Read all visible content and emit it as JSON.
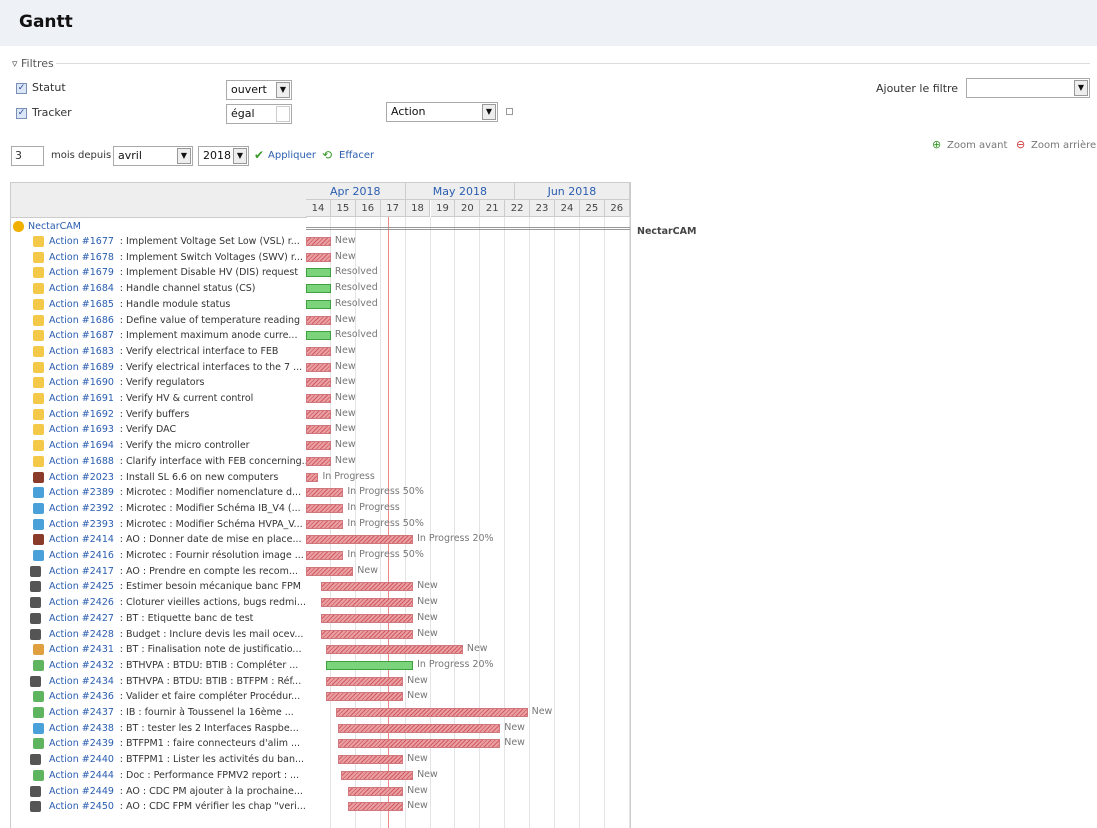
{
  "page": {
    "title": "Gantt"
  },
  "filters": {
    "legend": "▿ Filtres",
    "statut": {
      "label": "Statut",
      "operator": "ouvert"
    },
    "tracker": {
      "label": "Tracker",
      "operator": "égal",
      "value": "Action"
    },
    "add_filter_label": "Ajouter le filtre",
    "add_filter_value": ""
  },
  "controls": {
    "months": "3",
    "months_label": "mois depuis",
    "month_value": "avril",
    "year_value": "2018",
    "apply": "Appliquer",
    "clear": "Effacer",
    "zoom_in": "Zoom avant",
    "zoom_out": "Zoom arrière"
  },
  "timeline": {
    "months": [
      "Apr 2018",
      "May 2018",
      "Jun 2018"
    ],
    "weeks": [
      "14",
      "15",
      "16",
      "17",
      "18",
      "19",
      "20",
      "21",
      "22",
      "23",
      "24",
      "25",
      "26"
    ]
  },
  "project": {
    "name": "NectarCAM"
  },
  "colors": {
    "late": "#d45a61",
    "done": "#7bd37b",
    "todo": "#aaaaaa",
    "link": "#2a5db0"
  },
  "issues": [
    {
      "id": "Action #1677",
      "subject": "Implement Voltage Set Low (VSL) r...",
      "status": "New",
      "icon": "folder"
    },
    {
      "id": "Action #1678",
      "subject": "Implement Switch Voltages (SWV) r...",
      "status": "New",
      "icon": "folder"
    },
    {
      "id": "Action #1679",
      "subject": "Implement Disable HV (DIS) request",
      "status": "Resolved",
      "icon": "folder"
    },
    {
      "id": "Action #1684",
      "subject": "Handle channel status (CS)",
      "status": "Resolved",
      "icon": "folder"
    },
    {
      "id": "Action #1685",
      "subject": "Handle module status",
      "status": "Resolved",
      "icon": "folder"
    },
    {
      "id": "Action #1686",
      "subject": "Define value of temperature reading",
      "status": "New",
      "icon": "folder"
    },
    {
      "id": "Action #1687",
      "subject": "Implement maximum anode curre...",
      "status": "Resolved",
      "icon": "folder"
    },
    {
      "id": "Action #1683",
      "subject": "Verify electrical interface to FEB",
      "status": "New",
      "icon": "folder"
    },
    {
      "id": "Action #1689",
      "subject": "Verify electrical interfaces to the 7 ...",
      "status": "New",
      "icon": "folder"
    },
    {
      "id": "Action #1690",
      "subject": "Verify regulators",
      "status": "New",
      "icon": "folder"
    },
    {
      "id": "Action #1691",
      "subject": "Verify HV & current control",
      "status": "New",
      "icon": "folder"
    },
    {
      "id": "Action #1692",
      "subject": "Verify buffers",
      "status": "New",
      "icon": "folder"
    },
    {
      "id": "Action #1693",
      "subject": "Verify DAC",
      "status": "New",
      "icon": "folder"
    },
    {
      "id": "Action #1694",
      "subject": "Verify the micro controller",
      "status": "New",
      "icon": "folder"
    },
    {
      "id": "Action #1688",
      "subject": "Clarify interface with FEB concerning...",
      "status": "New",
      "icon": "folder"
    },
    {
      "id": "Action #2023",
      "subject": "Install SL 6.6 on new computers",
      "status": "In Progress",
      "icon": "avatar"
    },
    {
      "id": "Action #2389",
      "subject": "Microtec : Modifier nomenclature d...",
      "status": "In Progress 50%",
      "icon": "gear"
    },
    {
      "id": "Action #2392",
      "subject": "Microtec : Modifier Schéma IB_V4 (...",
      "status": "In Progress",
      "icon": "gear"
    },
    {
      "id": "Action #2393",
      "subject": "Microtec : Modifier Schéma HVPA_V...",
      "status": "In Progress 50%",
      "icon": "gear"
    },
    {
      "id": "Action #2414",
      "subject": "AO : Donner date de mise en place...",
      "status": "In Progress 20%",
      "icon": "avatar"
    },
    {
      "id": "Action #2416",
      "subject": "Microtec : Fournir résolution image ...",
      "status": "In Progress 50%",
      "icon": "gear"
    },
    {
      "id": "Action #2417",
      "subject": "AO : Prendre en compte les recom...",
      "status": "New",
      "icon": "person"
    },
    {
      "id": "Action #2425",
      "subject": "Estimer besoin mécanique banc FPM",
      "status": "New",
      "icon": "person"
    },
    {
      "id": "Action #2426",
      "subject": "Cloturer vieilles actions, bugs redmi...",
      "status": "New",
      "icon": "person"
    },
    {
      "id": "Action #2427",
      "subject": "BT : Etiquette banc de test",
      "status": "New",
      "icon": "person"
    },
    {
      "id": "Action #2428",
      "subject": "Budget : Inclure devis les mail ocev...",
      "status": "New",
      "icon": "person"
    },
    {
      "id": "Action #2431",
      "subject": "BT : Finalisation note de justificatio...",
      "status": "New",
      "icon": "star"
    },
    {
      "id": "Action #2432",
      "subject": "BTHVPA : BTDU: BTIB : Compléter ...",
      "status": "In Progress 20%",
      "icon": "leaf"
    },
    {
      "id": "Action #2434",
      "subject": "BTHVPA : BTDU: BTIB : BTFPM : Réf...",
      "status": "New",
      "icon": "person"
    },
    {
      "id": "Action #2436",
      "subject": "Valider et faire compléter Procédur...",
      "status": "New",
      "icon": "leaf"
    },
    {
      "id": "Action #2437",
      "subject": "IB : fournir à Toussenel la 16ème ...",
      "status": "New",
      "icon": "leaf"
    },
    {
      "id": "Action #2438",
      "subject": "BT : tester les 2 Interfaces Raspbe...",
      "status": "New",
      "icon": "gear"
    },
    {
      "id": "Action #2439",
      "subject": "BTFPM1 : faire connecteurs d'alim ...",
      "status": "New",
      "icon": "leaf"
    },
    {
      "id": "Action #2440",
      "subject": "BTFPM1 : Lister les activités du ban...",
      "status": "New",
      "icon": "person"
    },
    {
      "id": "Action #2444",
      "subject": "Doc : Performance FPMV2 report : ...",
      "status": "New",
      "icon": "leaf"
    },
    {
      "id": "Action #2449",
      "subject": "AO : CDC PM ajouter à la prochaine...",
      "status": "New",
      "icon": "person"
    },
    {
      "id": "Action #2450",
      "subject": "AO : CDC FPM vérifier les chap \"veri...",
      "status": "New",
      "icon": "person"
    }
  ]
}
